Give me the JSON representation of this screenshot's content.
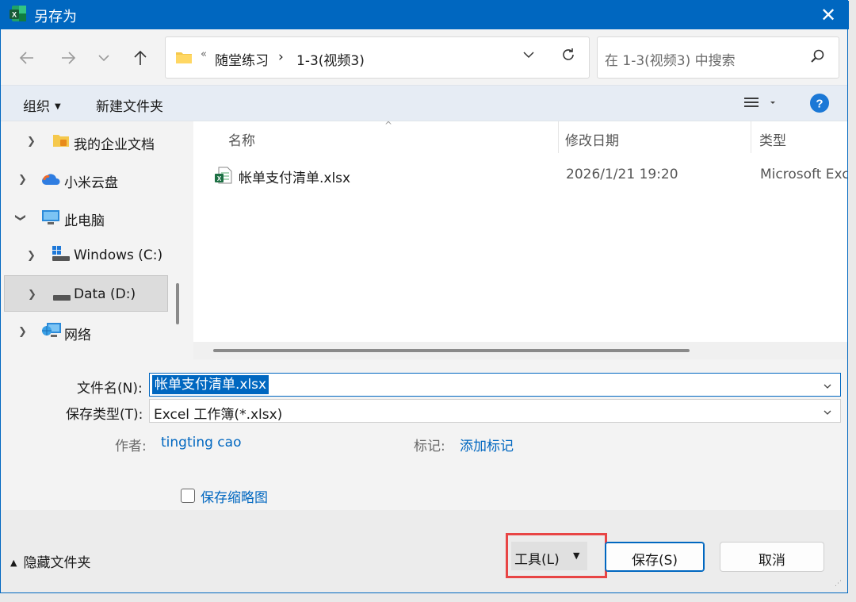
{
  "window": {
    "title": "另存为",
    "close_glyph": "✕"
  },
  "address": {
    "overflow": "«",
    "crumbs": [
      "随堂练习",
      "1-3(视频3)"
    ],
    "separator": "›"
  },
  "search": {
    "placeholder": "在 1-3(视频3) 中搜索"
  },
  "toolbar": {
    "organize": "组织",
    "new_folder": "新建文件夹"
  },
  "tree": [
    {
      "label": "我的企业文档",
      "icon": "enterprise-docs-icon"
    },
    {
      "label": "小米云盘",
      "icon": "cloud-icon"
    },
    {
      "label": "此电脑",
      "icon": "computer-icon"
    },
    {
      "label": "Windows (C:)",
      "icon": "drive-c-icon"
    },
    {
      "label": "Data (D:)",
      "icon": "drive-d-icon"
    },
    {
      "label": "网络",
      "icon": "network-icon"
    }
  ],
  "columns": {
    "name": "名称",
    "modified": "修改日期",
    "type": "类型"
  },
  "files": [
    {
      "name": "帐单支付清单.xlsx",
      "modified": "2026/1/21 19:20",
      "type": "Microsoft Excel"
    }
  ],
  "form": {
    "filename_label": "文件名(N):",
    "filename_value": "帐单支付清单.xlsx",
    "filetype_label": "保存类型(T):",
    "filetype_value": "Excel 工作簿(*.xlsx)",
    "author_label": "作者:",
    "author_value": "tingting cao",
    "tags_label": "标记:",
    "tags_value": "添加标记",
    "thumbnail_label": "保存缩略图"
  },
  "footer": {
    "hide_folders": "隐藏文件夹",
    "tools": "工具(L)",
    "save": "保存(S)",
    "cancel": "取消"
  },
  "colors": {
    "accent": "#0067c0",
    "highlight": "#e84545",
    "excel_green": "#1d7044"
  }
}
